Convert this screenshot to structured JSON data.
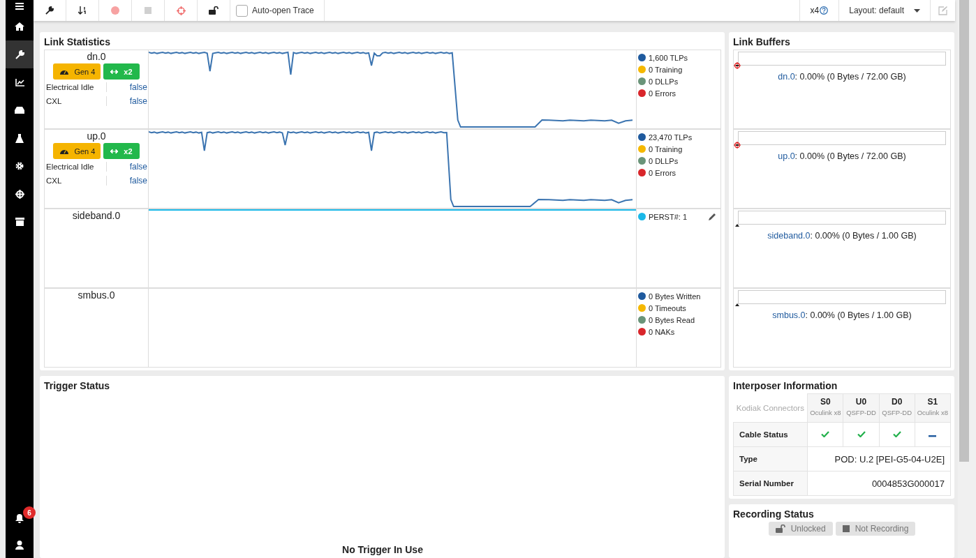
{
  "sidebar": {
    "items": [
      {
        "kind": "menu",
        "selected": false
      },
      {
        "kind": "home",
        "selected": false
      },
      {
        "kind": "wrench",
        "selected": true
      },
      {
        "kind": "chart",
        "selected": false
      },
      {
        "kind": "drive",
        "selected": false
      },
      {
        "kind": "flask",
        "selected": false
      },
      {
        "kind": "gear",
        "selected": false
      },
      {
        "kind": "crosshair",
        "selected": false
      },
      {
        "kind": "archive",
        "selected": false
      }
    ],
    "bottom": [
      {
        "kind": "bell",
        "badge": "6"
      },
      {
        "kind": "user"
      }
    ]
  },
  "toolbar": {
    "tools": [
      {
        "kind": "wrench",
        "disabled": false
      },
      {
        "kind": "sort",
        "disabled": false
      },
      {
        "kind": "record",
        "disabled": true
      },
      {
        "kind": "stop",
        "disabled": true
      },
      {
        "kind": "target",
        "disabled": false
      },
      {
        "kind": "unlock",
        "disabled": false
      }
    ],
    "auto_open": {
      "label": "Auto-open Trace",
      "checked": false
    },
    "scale": "x4",
    "layout": "Layout: default",
    "edit_disabled": true
  },
  "link_statistics": {
    "title": "Link Statistics",
    "links": [
      {
        "name": "dn.0",
        "kind": "traffic",
        "badges": [
          {
            "kind": "speed",
            "label": "Gen 4"
          },
          {
            "kind": "width",
            "label": "x2"
          }
        ],
        "props": [
          {
            "label": "Electrical Idle",
            "value": "false"
          },
          {
            "label": "CXL",
            "value": "false"
          }
        ],
        "legend": [
          {
            "label": "1,600 TLPs",
            "color": "#1f5a9e",
            "editable": false
          },
          {
            "label": "0 Training",
            "color": "#f5b800",
            "editable": false
          },
          {
            "label": "0 DLLPs",
            "color": "#6a9479",
            "editable": false
          },
          {
            "label": "0 Errors",
            "color": "#d9262b",
            "editable": false
          }
        ]
      },
      {
        "name": "up.0",
        "kind": "traffic",
        "badges": [
          {
            "kind": "speed",
            "label": "Gen 4"
          },
          {
            "kind": "width",
            "label": "x2"
          }
        ],
        "props": [
          {
            "label": "Electrical Idle",
            "value": "false"
          },
          {
            "label": "CXL",
            "value": "false"
          }
        ],
        "legend": [
          {
            "label": "23,470 TLPs",
            "color": "#1f5a9e",
            "editable": false
          },
          {
            "label": "0 Training",
            "color": "#f5b800",
            "editable": false
          },
          {
            "label": "0 DLLPs",
            "color": "#6a9479",
            "editable": false
          },
          {
            "label": "0 Errors",
            "color": "#d9262b",
            "editable": false
          }
        ]
      },
      {
        "name": "sideband.0",
        "kind": "flat",
        "legend": [
          {
            "label": "PERST#: 1",
            "color": "#1ab8e8",
            "editable": true
          }
        ]
      },
      {
        "name": "smbus.0",
        "kind": "idle",
        "legend": [
          {
            "label": "0 Bytes Written",
            "color": "#1f5a9e",
            "editable": false
          },
          {
            "label": "0 Timeouts",
            "color": "#f5b800",
            "editable": false
          },
          {
            "label": "0 Bytes Read",
            "color": "#6a9479",
            "editable": false
          },
          {
            "label": "0 NAKs",
            "color": "#d9262b",
            "editable": false
          }
        ]
      }
    ]
  },
  "link_buffers": {
    "title": "Link Buffers",
    "buffers": [
      {
        "name": "dn.0",
        "detail": ": 0.00% (0 Bytes / 72.00 GB)",
        "level": 0,
        "kind": "target"
      },
      {
        "name": "up.0",
        "detail": ": 0.00% (0 Bytes / 72.00 GB)",
        "level": 0,
        "kind": "target"
      },
      {
        "name": "sideband.0",
        "detail": ": 0.00% (0 Bytes / 1.00 GB)",
        "level": 0,
        "kind": "triangle"
      },
      {
        "name": "smbus.0",
        "detail": ": 0.00% (0 Bytes / 1.00 GB)",
        "level": 0,
        "kind": "triangle"
      }
    ]
  },
  "trigger_status": {
    "title": "Trigger Status",
    "message": "No Trigger In Use"
  },
  "interposer": {
    "title": "Interposer Information",
    "corner": "Kodiak Connectors",
    "connectors": [
      {
        "id": "S0",
        "type": "Oculink x8"
      },
      {
        "id": "U0",
        "type": "QSFP-DD"
      },
      {
        "id": "D0",
        "type": "QSFP-DD"
      },
      {
        "id": "S1",
        "type": "Oculink x8"
      }
    ],
    "cable_status": {
      "label": "Cable Status",
      "values": [
        {
          "connected": true
        },
        {
          "connected": true
        },
        {
          "connected": true
        },
        {
          "connected": false
        }
      ]
    },
    "rows": [
      {
        "label": "Type",
        "value": "POD: U.2 [PEI-G5-04-U2E]"
      },
      {
        "label": "Serial Number",
        "value": "0004853G000017"
      }
    ]
  },
  "recording_status": {
    "title": "Recording Status",
    "buttons": [
      {
        "kind": "lock",
        "label": "Unlocked",
        "disabled": true
      },
      {
        "kind": "record",
        "label": "Not Recording",
        "disabled": true
      }
    ]
  }
}
